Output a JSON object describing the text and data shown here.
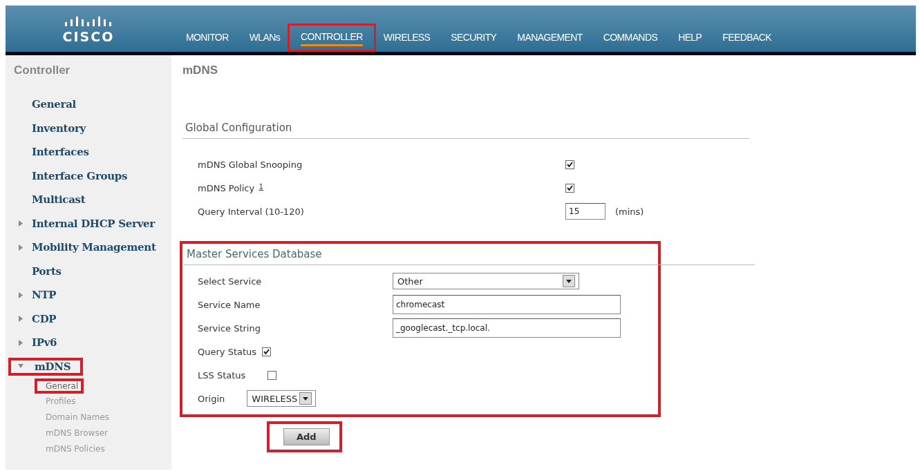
{
  "logo": {
    "text": "CISCO"
  },
  "nav": [
    {
      "label": "MONITOR",
      "selected": false,
      "highlighted": false
    },
    {
      "label": "WLANs",
      "selected": false,
      "highlighted": false
    },
    {
      "label": "CONTROLLER",
      "selected": true,
      "highlighted": true
    },
    {
      "label": "WIRELESS",
      "selected": false,
      "highlighted": false
    },
    {
      "label": "SECURITY",
      "selected": false,
      "highlighted": false
    },
    {
      "label": "MANAGEMENT",
      "selected": false,
      "highlighted": false
    },
    {
      "label": "COMMANDS",
      "selected": false,
      "highlighted": false
    },
    {
      "label": "HELP",
      "selected": false,
      "highlighted": false
    },
    {
      "label": "FEEDBACK",
      "selected": false,
      "highlighted": false
    }
  ],
  "sidebar": {
    "title": "Controller",
    "items": [
      {
        "label": "General",
        "highlighted": false
      },
      {
        "label": "Inventory",
        "highlighted": false
      },
      {
        "label": "Interfaces",
        "highlighted": false
      },
      {
        "label": "Interface Groups",
        "highlighted": false
      },
      {
        "label": "Multicast",
        "highlighted": false
      },
      {
        "label": "Internal DHCP Server",
        "expanded": false,
        "highlighted": false
      },
      {
        "label": "Mobility Management",
        "expanded": false,
        "highlighted": false
      },
      {
        "label": "Ports",
        "highlighted": false
      },
      {
        "label": "NTP",
        "expanded": false,
        "highlighted": false
      },
      {
        "label": "CDP",
        "expanded": false,
        "highlighted": false
      },
      {
        "label": "IPv6",
        "expanded": false,
        "highlighted": false
      },
      {
        "label": "mDNS",
        "expanded": true,
        "highlighted": true,
        "children": [
          {
            "label": "General",
            "selected": true,
            "highlighted": true
          },
          {
            "label": "Profiles",
            "selected": false,
            "highlighted": false
          },
          {
            "label": "Domain Names",
            "selected": false,
            "highlighted": false
          },
          {
            "label": "mDNS Browser",
            "selected": false,
            "highlighted": false
          },
          {
            "label": "mDNS Policies",
            "selected": false,
            "highlighted": false
          }
        ]
      }
    ]
  },
  "page_title": "mDNS",
  "global_configuration": {
    "title": "Global Configuration",
    "rows": [
      {
        "kind": "checkbox",
        "label": "mDNS Global Snooping",
        "checked": true
      },
      {
        "kind": "checkbox",
        "label": "mDNS Policy",
        "note": "1",
        "checked": true
      },
      {
        "kind": "text",
        "label": "Query Interval (10-120)",
        "value": "15",
        "unit": "(mins)"
      }
    ]
  },
  "master_services_database": {
    "title": "Master Services Database",
    "highlighted": true,
    "rows": [
      {
        "kind": "select",
        "label": "Select Service",
        "value": "Other"
      },
      {
        "kind": "text",
        "label": "Service Name",
        "value": "chromecast"
      },
      {
        "kind": "text",
        "label": "Service String",
        "value": "_googlecast._tcp.local."
      },
      {
        "kind": "checkbox",
        "label": "Query Status",
        "checked": true
      },
      {
        "kind": "checkbox",
        "label": "LSS Status",
        "checked": false
      },
      {
        "kind": "smallselect",
        "label": "Origin",
        "value": "WIRELESS"
      }
    ]
  },
  "add_button": {
    "label": "Add",
    "highlighted": true
  }
}
